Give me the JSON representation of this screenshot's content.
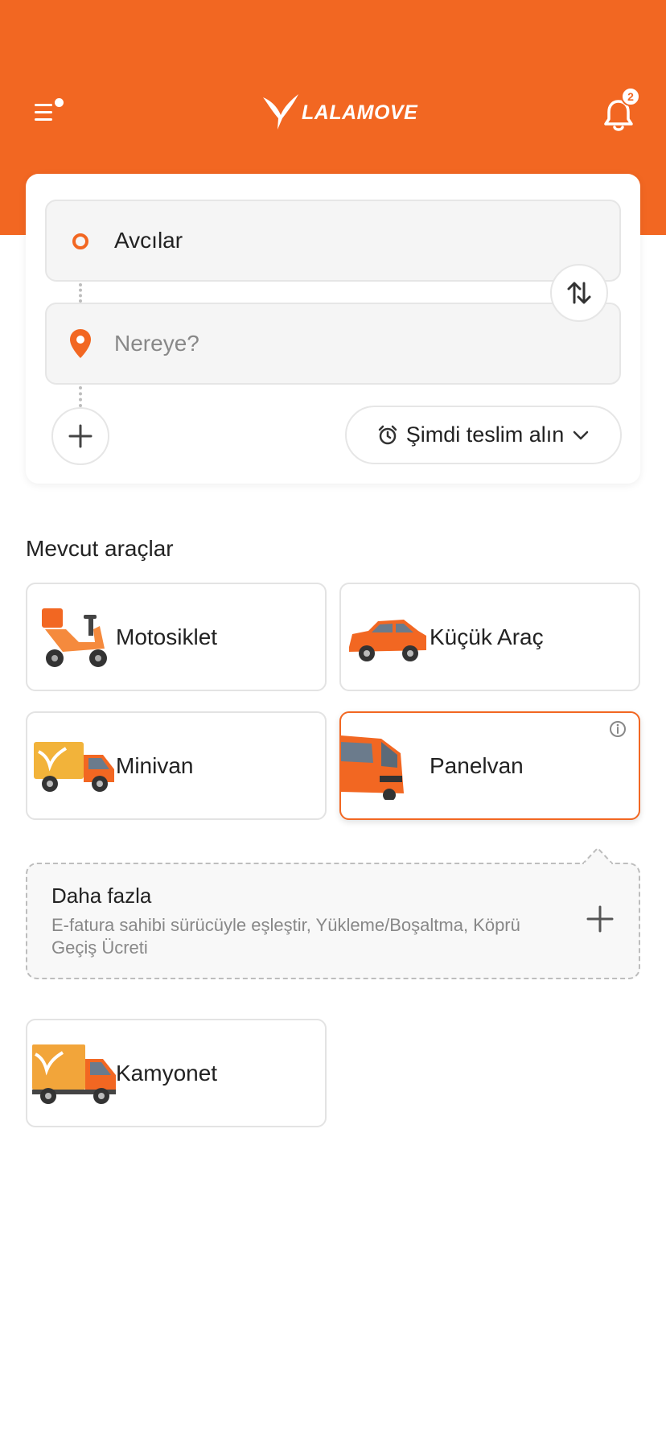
{
  "header": {
    "brand": "LALAMOVE",
    "notification_count": "2"
  },
  "route": {
    "pickup_value": "Avcılar",
    "dropoff_placeholder": "Nereye?",
    "schedule_label": "Şimdi teslim alın"
  },
  "vehicles": {
    "section_title": "Mevcut araçlar",
    "items": [
      {
        "label": "Motosiklet",
        "selected": false
      },
      {
        "label": "Küçük Araç",
        "selected": false
      },
      {
        "label": "Minivan",
        "selected": false
      },
      {
        "label": "Panelvan",
        "selected": true
      },
      {
        "label": "Kamyonet",
        "selected": false
      }
    ]
  },
  "more": {
    "title": "Daha fazla",
    "description": "E-fatura sahibi sürücüyle eşleştir, Yükleme/Boşaltma, Köprü Geçiş Ücreti"
  },
  "colors": {
    "accent": "#f26722",
    "border": "#e3e3e3"
  },
  "icons": [
    "menu-icon",
    "lalamove-bird-icon",
    "bell-icon",
    "pickup-ring-icon",
    "pin-icon",
    "swap-icon",
    "plus-icon",
    "alarm-clock-icon",
    "chevron-down-icon",
    "info-icon"
  ]
}
